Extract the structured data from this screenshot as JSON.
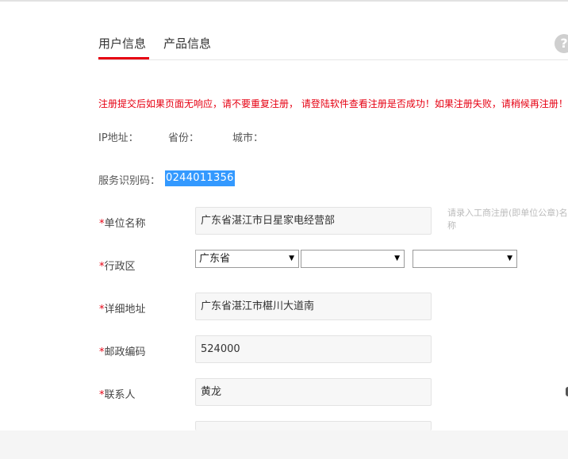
{
  "tabs": [
    {
      "label": "用户信息",
      "active": true
    },
    {
      "label": "产品信息",
      "active": false
    }
  ],
  "help": {
    "icon": "help-circle-icon",
    "glyph": "?"
  },
  "warning": "注册提交后如果页面无响应，请不要重复注册， 请登陆软件查看注册是否成功！如果注册失败，请稍候再注册！",
  "info": {
    "ip_label": "IP地址：",
    "province_label": "省份：",
    "city_label": "城市："
  },
  "service": {
    "label": "服务识别码：",
    "value": "0244011356"
  },
  "form": {
    "required_mark": "*",
    "unit_name": {
      "label": "单位名称",
      "value": "广东省湛江市日星家电经营部"
    },
    "unit_hint": "请录入工商注册(即单位公章)名称",
    "region": {
      "label": "行政区",
      "province": "广东省",
      "city": "",
      "district": ""
    },
    "address": {
      "label": "详细地址",
      "value": "广东省湛江市椹川大道南"
    },
    "postcode": {
      "label": "邮政编码",
      "value": "524000"
    },
    "contact": {
      "label": "联系人",
      "value": "黄龙"
    }
  },
  "colors": {
    "accent": "#e60012",
    "selection": "#3399ff"
  }
}
